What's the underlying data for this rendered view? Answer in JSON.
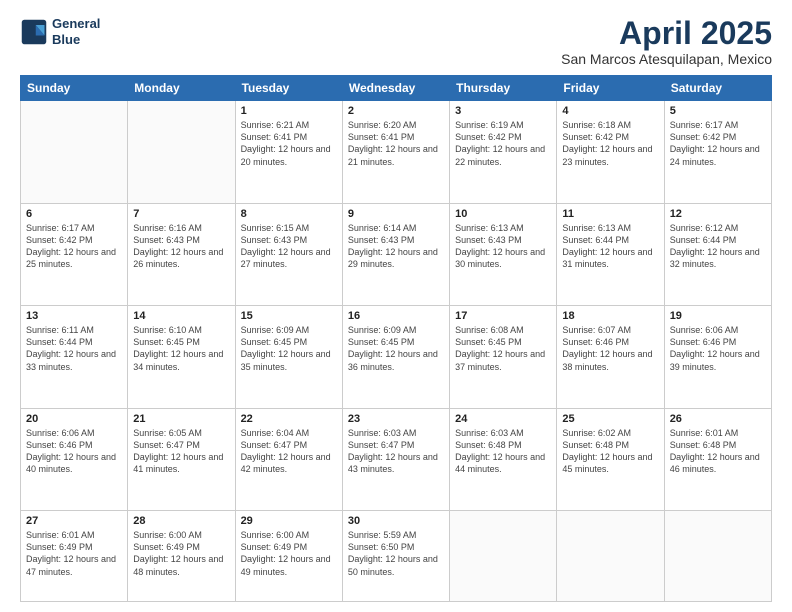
{
  "logo": {
    "line1": "General",
    "line2": "Blue"
  },
  "title": "April 2025",
  "subtitle": "San Marcos Atesquilapan, Mexico",
  "weekdays": [
    "Sunday",
    "Monday",
    "Tuesday",
    "Wednesday",
    "Thursday",
    "Friday",
    "Saturday"
  ],
  "weeks": [
    [
      {
        "day": "",
        "sunrise": "",
        "sunset": "",
        "daylight": ""
      },
      {
        "day": "",
        "sunrise": "",
        "sunset": "",
        "daylight": ""
      },
      {
        "day": "1",
        "sunrise": "Sunrise: 6:21 AM",
        "sunset": "Sunset: 6:41 PM",
        "daylight": "Daylight: 12 hours and 20 minutes."
      },
      {
        "day": "2",
        "sunrise": "Sunrise: 6:20 AM",
        "sunset": "Sunset: 6:41 PM",
        "daylight": "Daylight: 12 hours and 21 minutes."
      },
      {
        "day": "3",
        "sunrise": "Sunrise: 6:19 AM",
        "sunset": "Sunset: 6:42 PM",
        "daylight": "Daylight: 12 hours and 22 minutes."
      },
      {
        "day": "4",
        "sunrise": "Sunrise: 6:18 AM",
        "sunset": "Sunset: 6:42 PM",
        "daylight": "Daylight: 12 hours and 23 minutes."
      },
      {
        "day": "5",
        "sunrise": "Sunrise: 6:17 AM",
        "sunset": "Sunset: 6:42 PM",
        "daylight": "Daylight: 12 hours and 24 minutes."
      }
    ],
    [
      {
        "day": "6",
        "sunrise": "Sunrise: 6:17 AM",
        "sunset": "Sunset: 6:42 PM",
        "daylight": "Daylight: 12 hours and 25 minutes."
      },
      {
        "day": "7",
        "sunrise": "Sunrise: 6:16 AM",
        "sunset": "Sunset: 6:43 PM",
        "daylight": "Daylight: 12 hours and 26 minutes."
      },
      {
        "day": "8",
        "sunrise": "Sunrise: 6:15 AM",
        "sunset": "Sunset: 6:43 PM",
        "daylight": "Daylight: 12 hours and 27 minutes."
      },
      {
        "day": "9",
        "sunrise": "Sunrise: 6:14 AM",
        "sunset": "Sunset: 6:43 PM",
        "daylight": "Daylight: 12 hours and 29 minutes."
      },
      {
        "day": "10",
        "sunrise": "Sunrise: 6:13 AM",
        "sunset": "Sunset: 6:43 PM",
        "daylight": "Daylight: 12 hours and 30 minutes."
      },
      {
        "day": "11",
        "sunrise": "Sunrise: 6:13 AM",
        "sunset": "Sunset: 6:44 PM",
        "daylight": "Daylight: 12 hours and 31 minutes."
      },
      {
        "day": "12",
        "sunrise": "Sunrise: 6:12 AM",
        "sunset": "Sunset: 6:44 PM",
        "daylight": "Daylight: 12 hours and 32 minutes."
      }
    ],
    [
      {
        "day": "13",
        "sunrise": "Sunrise: 6:11 AM",
        "sunset": "Sunset: 6:44 PM",
        "daylight": "Daylight: 12 hours and 33 minutes."
      },
      {
        "day": "14",
        "sunrise": "Sunrise: 6:10 AM",
        "sunset": "Sunset: 6:45 PM",
        "daylight": "Daylight: 12 hours and 34 minutes."
      },
      {
        "day": "15",
        "sunrise": "Sunrise: 6:09 AM",
        "sunset": "Sunset: 6:45 PM",
        "daylight": "Daylight: 12 hours and 35 minutes."
      },
      {
        "day": "16",
        "sunrise": "Sunrise: 6:09 AM",
        "sunset": "Sunset: 6:45 PM",
        "daylight": "Daylight: 12 hours and 36 minutes."
      },
      {
        "day": "17",
        "sunrise": "Sunrise: 6:08 AM",
        "sunset": "Sunset: 6:45 PM",
        "daylight": "Daylight: 12 hours and 37 minutes."
      },
      {
        "day": "18",
        "sunrise": "Sunrise: 6:07 AM",
        "sunset": "Sunset: 6:46 PM",
        "daylight": "Daylight: 12 hours and 38 minutes."
      },
      {
        "day": "19",
        "sunrise": "Sunrise: 6:06 AM",
        "sunset": "Sunset: 6:46 PM",
        "daylight": "Daylight: 12 hours and 39 minutes."
      }
    ],
    [
      {
        "day": "20",
        "sunrise": "Sunrise: 6:06 AM",
        "sunset": "Sunset: 6:46 PM",
        "daylight": "Daylight: 12 hours and 40 minutes."
      },
      {
        "day": "21",
        "sunrise": "Sunrise: 6:05 AM",
        "sunset": "Sunset: 6:47 PM",
        "daylight": "Daylight: 12 hours and 41 minutes."
      },
      {
        "day": "22",
        "sunrise": "Sunrise: 6:04 AM",
        "sunset": "Sunset: 6:47 PM",
        "daylight": "Daylight: 12 hours and 42 minutes."
      },
      {
        "day": "23",
        "sunrise": "Sunrise: 6:03 AM",
        "sunset": "Sunset: 6:47 PM",
        "daylight": "Daylight: 12 hours and 43 minutes."
      },
      {
        "day": "24",
        "sunrise": "Sunrise: 6:03 AM",
        "sunset": "Sunset: 6:48 PM",
        "daylight": "Daylight: 12 hours and 44 minutes."
      },
      {
        "day": "25",
        "sunrise": "Sunrise: 6:02 AM",
        "sunset": "Sunset: 6:48 PM",
        "daylight": "Daylight: 12 hours and 45 minutes."
      },
      {
        "day": "26",
        "sunrise": "Sunrise: 6:01 AM",
        "sunset": "Sunset: 6:48 PM",
        "daylight": "Daylight: 12 hours and 46 minutes."
      }
    ],
    [
      {
        "day": "27",
        "sunrise": "Sunrise: 6:01 AM",
        "sunset": "Sunset: 6:49 PM",
        "daylight": "Daylight: 12 hours and 47 minutes."
      },
      {
        "day": "28",
        "sunrise": "Sunrise: 6:00 AM",
        "sunset": "Sunset: 6:49 PM",
        "daylight": "Daylight: 12 hours and 48 minutes."
      },
      {
        "day": "29",
        "sunrise": "Sunrise: 6:00 AM",
        "sunset": "Sunset: 6:49 PM",
        "daylight": "Daylight: 12 hours and 49 minutes."
      },
      {
        "day": "30",
        "sunrise": "Sunrise: 5:59 AM",
        "sunset": "Sunset: 6:50 PM",
        "daylight": "Daylight: 12 hours and 50 minutes."
      },
      {
        "day": "",
        "sunrise": "",
        "sunset": "",
        "daylight": ""
      },
      {
        "day": "",
        "sunrise": "",
        "sunset": "",
        "daylight": ""
      },
      {
        "day": "",
        "sunrise": "",
        "sunset": "",
        "daylight": ""
      }
    ]
  ]
}
